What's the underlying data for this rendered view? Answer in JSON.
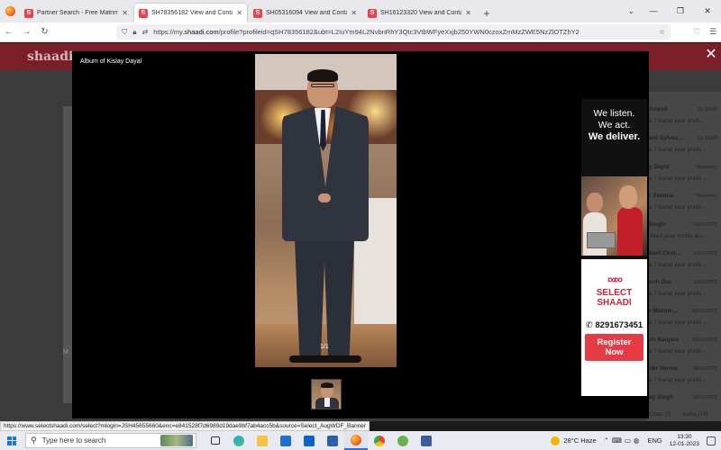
{
  "browser": {
    "tabs": [
      {
        "label": "Partner Search - Free Matrimonial",
        "active": false
      },
      {
        "label": "SH78356182 View and Contact D",
        "active": true
      },
      {
        "label": "SH05316094 View and Contact C",
        "active": false
      },
      {
        "label": "SH16123320 View and Contact C",
        "active": false
      }
    ],
    "url_prefix": "https://my.",
    "url_domain": "shaadi.com",
    "url_rest": "/profile?profileid=qSH78356182&ubt=L2IuYm94L2NvbnRhY3Qtc3VtbWFyeXxjb250YWN0czoxZmMzZWE5NzZlOTZhY2",
    "status_url": "https://www.selectshaadi.com/select?mlogin=JSH45655660&enc=e841528f7d6989d19dae9bf7ab4acc5b&source=Select_AugWDF_Banner"
  },
  "page": {
    "logo_text": "shaadi",
    "left_label": "M"
  },
  "chat": {
    "items": [
      {
        "name": "Anand",
        "time": "11:20AM",
        "msg": "lo, I found your profi..."
      },
      {
        "name": "ard Sylves...",
        "time": "11:18AM",
        "msg": "lo, I found your profil..."
      },
      {
        "name": "y Dayal",
        "time": "Yesterday",
        "msg": "lo, I found your profil..."
      },
      {
        "name": "r Saxena",
        "time": "Yesterday",
        "msg": "lo, I found your profil..."
      },
      {
        "name": "Singh",
        "time": "12/01/2023",
        "msg": "I liked your profile an..."
      },
      {
        "name": "kant Chet...",
        "time": "10/01/2023",
        "msg": "lo, I found your profil..."
      },
      {
        "name": "osh Das",
        "time": "10/01/2023",
        "msg": "lo, I found your profil..."
      },
      {
        "name": "r Mazum...",
        "time": "09/01/2023",
        "msg": "lo, I found your profil..."
      },
      {
        "name": "sh Banjare",
        "time": "09/01/2023",
        "msg": "lo, I found your profil..."
      },
      {
        "name": "der Verma",
        "time": "08/01/2023",
        "msg": "lo, I found your profil..."
      },
      {
        "name": "ay Singh",
        "time": "08/01/2023",
        "msg": ""
      }
    ],
    "footer": [
      "Chats (3)",
      "Active (74)"
    ]
  },
  "lightbox": {
    "title": "Album of Kislay Dayal",
    "counter": "1/1",
    "close_symbol": "✕"
  },
  "ad": {
    "tag_line1": "We listen.",
    "tag_line2": "We act.",
    "tag_line3": "We deliver.",
    "brand_line1": "SELECT",
    "brand_line2": "SHAADI",
    "phone": "8291673451",
    "cta_line1": "Register",
    "cta_line2": "Now",
    "accent": "#e63a45"
  },
  "taskbar": {
    "search_placeholder": "Type here to search",
    "weather_temp": "28°C",
    "weather_desc": "Haze",
    "language": "ENG",
    "time": "13:30",
    "date": "12-01-2023"
  }
}
